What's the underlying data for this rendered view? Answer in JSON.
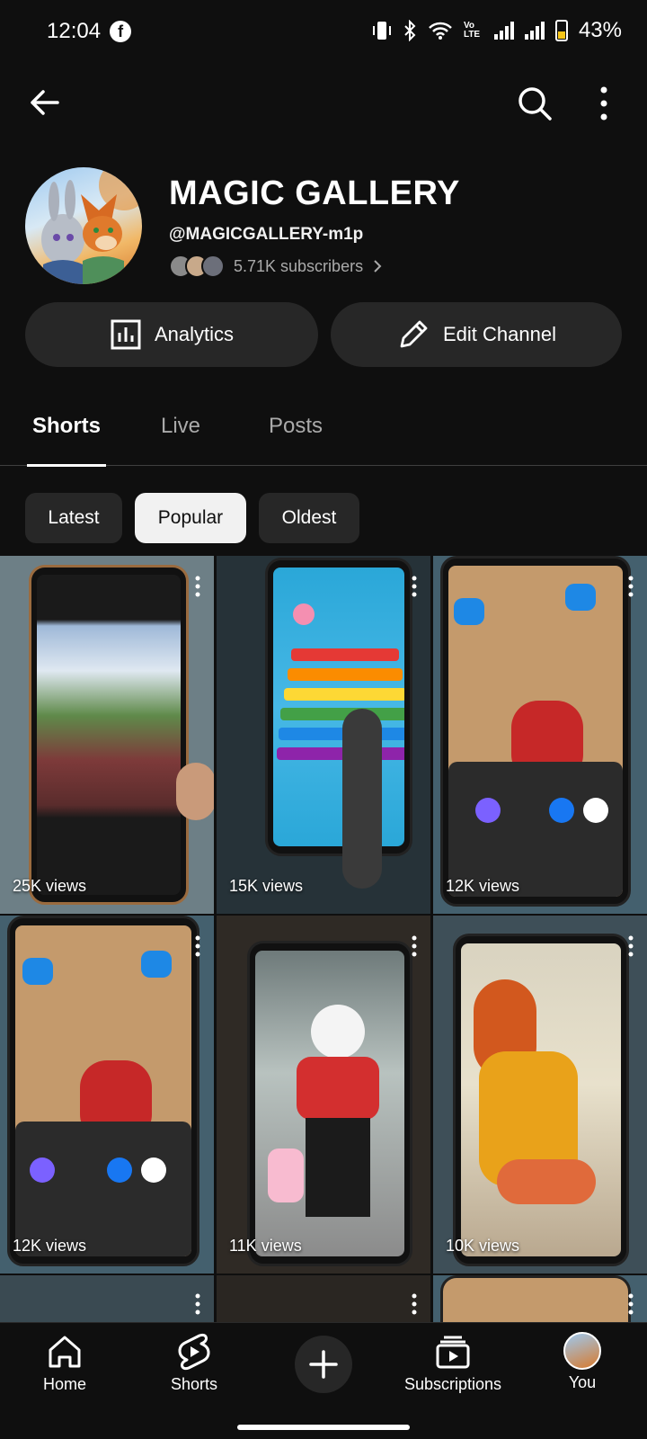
{
  "status_bar": {
    "time": "12:04",
    "battery": "43%",
    "network_label": "Vo LTE"
  },
  "channel": {
    "name": "MAGIC GALLERY",
    "handle": "@MAGICGALLERY-m1p",
    "subscribers": "5.71K subscribers",
    "analytics_label": "Analytics",
    "edit_label": "Edit Channel"
  },
  "tabs": [
    {
      "label": "Shorts",
      "active": true
    },
    {
      "label": "Live",
      "active": false
    },
    {
      "label": "Posts",
      "active": false
    }
  ],
  "chips": [
    {
      "label": "Latest",
      "selected": false
    },
    {
      "label": "Popular",
      "selected": true
    },
    {
      "label": "Oldest",
      "selected": false
    }
  ],
  "shorts": [
    {
      "views": "25K views"
    },
    {
      "views": "15K views"
    },
    {
      "views": "12K views"
    },
    {
      "views": "12K views"
    },
    {
      "views": "11K views"
    },
    {
      "views": "10K views"
    }
  ],
  "bottom_nav": [
    {
      "label": "Home",
      "icon": "home-icon"
    },
    {
      "label": "Shorts",
      "icon": "shorts-icon"
    },
    {
      "label": "",
      "icon": "plus-icon"
    },
    {
      "label": "Subscriptions",
      "icon": "subscriptions-icon"
    },
    {
      "label": "You",
      "icon": "avatar"
    }
  ],
  "colors": {
    "background": "#0f0f0f",
    "surface": "#272727",
    "text_secondary": "#aaaaaa",
    "chip_selected": "#f1f1f1"
  }
}
